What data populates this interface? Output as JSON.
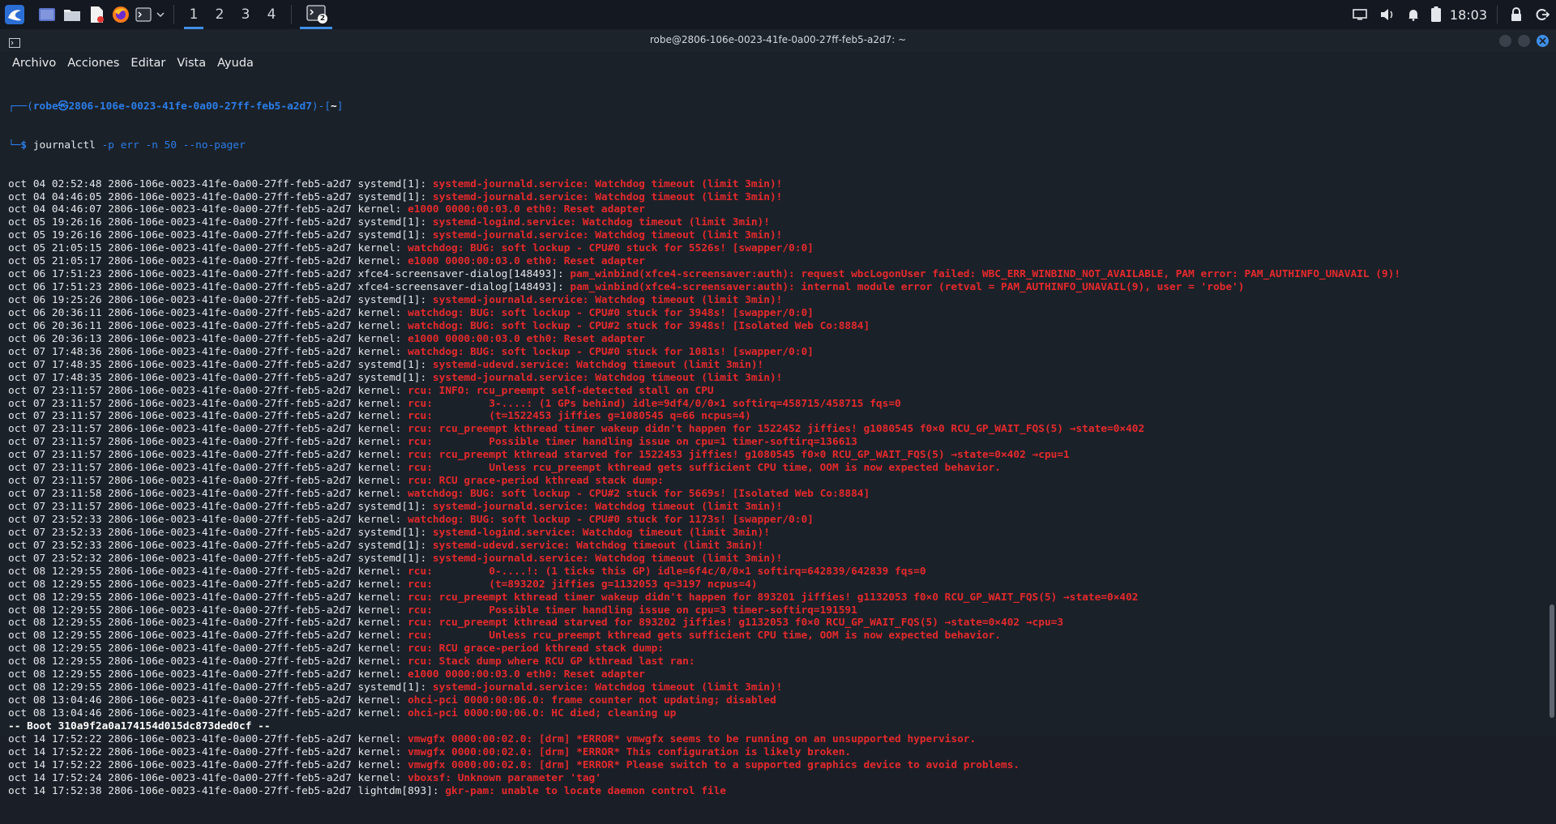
{
  "panel": {
    "workspaces": [
      "1",
      "2",
      "3",
      "4"
    ],
    "active_workspace": 0,
    "clock": "18:03",
    "task_badge": "2"
  },
  "window": {
    "title": "robe@2806-106e-0023-41fe-0a00-27ff-feb5-a2d7: ~",
    "menu": [
      "Archivo",
      "Acciones",
      "Editar",
      "Vista",
      "Ayuda"
    ]
  },
  "prompt": {
    "user_host": "robe㉿2806-106e-0023-41fe-0a00-27ff-feb5-a2d7",
    "path": "~",
    "command": "journalctl",
    "args": " -p err -n 50 --no-pager"
  },
  "log_lines": [
    {
      "p": "oct 04 02:52:48 2806-106e-0023-41fe-0a00-27ff-feb5-a2d7 systemd[1]: ",
      "m": "systemd-journald.service: Watchdog timeout (limit 3min)!"
    },
    {
      "p": "oct 04 04:46:05 2806-106e-0023-41fe-0a00-27ff-feb5-a2d7 systemd[1]: ",
      "m": "systemd-journald.service: Watchdog timeout (limit 3min)!"
    },
    {
      "p": "oct 04 04:46:07 2806-106e-0023-41fe-0a00-27ff-feb5-a2d7 kernel: ",
      "m": "e1000 0000:00:03.0 eth0: Reset adapter"
    },
    {
      "p": "oct 05 19:26:16 2806-106e-0023-41fe-0a00-27ff-feb5-a2d7 systemd[1]: ",
      "m": "systemd-logind.service: Watchdog timeout (limit 3min)!"
    },
    {
      "p": "oct 05 19:26:16 2806-106e-0023-41fe-0a00-27ff-feb5-a2d7 systemd[1]: ",
      "m": "systemd-journald.service: Watchdog timeout (limit 3min)!"
    },
    {
      "p": "oct 05 21:05:15 2806-106e-0023-41fe-0a00-27ff-feb5-a2d7 kernel: ",
      "m": "watchdog: BUG: soft lockup - CPU#0 stuck for 5526s! [swapper/0:0]"
    },
    {
      "p": "oct 05 21:05:17 2806-106e-0023-41fe-0a00-27ff-feb5-a2d7 kernel: ",
      "m": "e1000 0000:00:03.0 eth0: Reset adapter"
    },
    {
      "p": "oct 06 17:51:23 2806-106e-0023-41fe-0a00-27ff-feb5-a2d7 xfce4-screensaver-dialog[148493]: ",
      "m": "pam_winbind(xfce4-screensaver:auth): request wbcLogonUser failed: WBC_ERR_WINBIND_NOT_AVAILABLE, PAM error: PAM_AUTHINFO_UNAVAIL (9)!"
    },
    {
      "p": "oct 06 17:51:23 2806-106e-0023-41fe-0a00-27ff-feb5-a2d7 xfce4-screensaver-dialog[148493]: ",
      "m": "pam_winbind(xfce4-screensaver:auth): internal module error (retval = PAM_AUTHINFO_UNAVAIL(9), user = 'robe')"
    },
    {
      "p": "oct 06 19:25:26 2806-106e-0023-41fe-0a00-27ff-feb5-a2d7 systemd[1]: ",
      "m": "systemd-journald.service: Watchdog timeout (limit 3min)!"
    },
    {
      "p": "oct 06 20:36:11 2806-106e-0023-41fe-0a00-27ff-feb5-a2d7 kernel: ",
      "m": "watchdog: BUG: soft lockup - CPU#0 stuck for 3948s! [swapper/0:0]"
    },
    {
      "p": "oct 06 20:36:11 2806-106e-0023-41fe-0a00-27ff-feb5-a2d7 kernel: ",
      "m": "watchdog: BUG: soft lockup - CPU#2 stuck for 3948s! [Isolated Web Co:8884]"
    },
    {
      "p": "oct 06 20:36:13 2806-106e-0023-41fe-0a00-27ff-feb5-a2d7 kernel: ",
      "m": "e1000 0000:00:03.0 eth0: Reset adapter"
    },
    {
      "p": "oct 07 17:48:36 2806-106e-0023-41fe-0a00-27ff-feb5-a2d7 kernel: ",
      "m": "watchdog: BUG: soft lockup - CPU#0 stuck for 1081s! [swapper/0:0]"
    },
    {
      "p": "oct 07 17:48:35 2806-106e-0023-41fe-0a00-27ff-feb5-a2d7 systemd[1]: ",
      "m": "systemd-udevd.service: Watchdog timeout (limit 3min)!"
    },
    {
      "p": "oct 07 17:48:35 2806-106e-0023-41fe-0a00-27ff-feb5-a2d7 systemd[1]: ",
      "m": "systemd-journald.service: Watchdog timeout (limit 3min)!"
    },
    {
      "p": "oct 07 23:11:57 2806-106e-0023-41fe-0a00-27ff-feb5-a2d7 kernel: ",
      "m": "rcu: INFO: rcu_preempt self-detected stall on CPU"
    },
    {
      "p": "oct 07 23:11:57 2806-106e-0023-41fe-0a00-27ff-feb5-a2d7 kernel: ",
      "m": "rcu:         3-....: (1 GPs behind) idle=9df4/0/0×1 softirq=458715/458715 fqs=0"
    },
    {
      "p": "oct 07 23:11:57 2806-106e-0023-41fe-0a00-27ff-feb5-a2d7 kernel: ",
      "m": "rcu:         (t=1522453 jiffies g=1080545 q=66 ncpus=4)"
    },
    {
      "p": "oct 07 23:11:57 2806-106e-0023-41fe-0a00-27ff-feb5-a2d7 kernel: ",
      "m": "rcu: rcu_preempt kthread timer wakeup didn't happen for 1522452 jiffies! g1080545 f0×0 RCU_GP_WAIT_FQS(5) →state=0×402"
    },
    {
      "p": "oct 07 23:11:57 2806-106e-0023-41fe-0a00-27ff-feb5-a2d7 kernel: ",
      "m": "rcu:         Possible timer handling issue on cpu=1 timer-softirq=136613"
    },
    {
      "p": "oct 07 23:11:57 2806-106e-0023-41fe-0a00-27ff-feb5-a2d7 kernel: ",
      "m": "rcu: rcu_preempt kthread starved for 1522453 jiffies! g1080545 f0×0 RCU_GP_WAIT_FQS(5) →state=0×402 →cpu=1"
    },
    {
      "p": "oct 07 23:11:57 2806-106e-0023-41fe-0a00-27ff-feb5-a2d7 kernel: ",
      "m": "rcu:         Unless rcu_preempt kthread gets sufficient CPU time, OOM is now expected behavior."
    },
    {
      "p": "oct 07 23:11:57 2806-106e-0023-41fe-0a00-27ff-feb5-a2d7 kernel: ",
      "m": "rcu: RCU grace-period kthread stack dump:"
    },
    {
      "p": "oct 07 23:11:58 2806-106e-0023-41fe-0a00-27ff-feb5-a2d7 kernel: ",
      "m": "watchdog: BUG: soft lockup - CPU#2 stuck for 5669s! [Isolated Web Co:8884]"
    },
    {
      "p": "oct 07 23:11:57 2806-106e-0023-41fe-0a00-27ff-feb5-a2d7 systemd[1]: ",
      "m": "systemd-journald.service: Watchdog timeout (limit 3min)!"
    },
    {
      "p": "oct 07 23:52:33 2806-106e-0023-41fe-0a00-27ff-feb5-a2d7 kernel: ",
      "m": "watchdog: BUG: soft lockup - CPU#0 stuck for 1173s! [swapper/0:0]"
    },
    {
      "p": "oct 07 23:52:33 2806-106e-0023-41fe-0a00-27ff-feb5-a2d7 systemd[1]: ",
      "m": "systemd-logind.service: Watchdog timeout (limit 3min)!"
    },
    {
      "p": "oct 07 23:52:33 2806-106e-0023-41fe-0a00-27ff-feb5-a2d7 systemd[1]: ",
      "m": "systemd-udevd.service: Watchdog timeout (limit 3min)!"
    },
    {
      "p": "oct 07 23:52:32 2806-106e-0023-41fe-0a00-27ff-feb5-a2d7 systemd[1]: ",
      "m": "systemd-journald.service: Watchdog timeout (limit 3min)!"
    },
    {
      "p": "oct 08 12:29:55 2806-106e-0023-41fe-0a00-27ff-feb5-a2d7 kernel: ",
      "m": "rcu:         0-....!: (1 ticks this GP) idle=6f4c/0/0×1 softirq=642839/642839 fqs=0"
    },
    {
      "p": "oct 08 12:29:55 2806-106e-0023-41fe-0a00-27ff-feb5-a2d7 kernel: ",
      "m": "rcu:         (t=893202 jiffies g=1132053 q=3197 ncpus=4)"
    },
    {
      "p": "oct 08 12:29:55 2806-106e-0023-41fe-0a00-27ff-feb5-a2d7 kernel: ",
      "m": "rcu: rcu_preempt kthread timer wakeup didn't happen for 893201 jiffies! g1132053 f0×0 RCU_GP_WAIT_FQS(5) →state=0×402"
    },
    {
      "p": "oct 08 12:29:55 2806-106e-0023-41fe-0a00-27ff-feb5-a2d7 kernel: ",
      "m": "rcu:         Possible timer handling issue on cpu=3 timer-softirq=191591"
    },
    {
      "p": "oct 08 12:29:55 2806-106e-0023-41fe-0a00-27ff-feb5-a2d7 kernel: ",
      "m": "rcu: rcu_preempt kthread starved for 893202 jiffies! g1132053 f0×0 RCU_GP_WAIT_FQS(5) →state=0×402 →cpu=3"
    },
    {
      "p": "oct 08 12:29:55 2806-106e-0023-41fe-0a00-27ff-feb5-a2d7 kernel: ",
      "m": "rcu:         Unless rcu_preempt kthread gets sufficient CPU time, OOM is now expected behavior."
    },
    {
      "p": "oct 08 12:29:55 2806-106e-0023-41fe-0a00-27ff-feb5-a2d7 kernel: ",
      "m": "rcu: RCU grace-period kthread stack dump:"
    },
    {
      "p": "oct 08 12:29:55 2806-106e-0023-41fe-0a00-27ff-feb5-a2d7 kernel: ",
      "m": "rcu: Stack dump where RCU GP kthread last ran:"
    },
    {
      "p": "oct 08 12:29:55 2806-106e-0023-41fe-0a00-27ff-feb5-a2d7 kernel: ",
      "m": "e1000 0000:00:03.0 eth0: Reset adapter"
    },
    {
      "p": "oct 08 12:29:55 2806-106e-0023-41fe-0a00-27ff-feb5-a2d7 systemd[1]: ",
      "m": "systemd-journald.service: Watchdog timeout (limit 3min)!"
    },
    {
      "p": "oct 08 13:04:46 2806-106e-0023-41fe-0a00-27ff-feb5-a2d7 kernel: ",
      "m": "ohci-pci 0000:00:06.0: frame counter not updating; disabled"
    },
    {
      "p": "oct 08 13:04:46 2806-106e-0023-41fe-0a00-27ff-feb5-a2d7 kernel: ",
      "m": "ohci-pci 0000:00:06.0: HC died; cleaning up"
    },
    {
      "boot": "-- Boot 310a9f2a0a174154d015dc873ded0cf --"
    },
    {
      "p": "oct 14 17:52:22 2806-106e-0023-41fe-0a00-27ff-feb5-a2d7 kernel: ",
      "m": "vmwgfx 0000:00:02.0: [drm] *ERROR* vmwgfx seems to be running on an unsupported hypervisor."
    },
    {
      "p": "oct 14 17:52:22 2806-106e-0023-41fe-0a00-27ff-feb5-a2d7 kernel: ",
      "m": "vmwgfx 0000:00:02.0: [drm] *ERROR* This configuration is likely broken."
    },
    {
      "p": "oct 14 17:52:22 2806-106e-0023-41fe-0a00-27ff-feb5-a2d7 kernel: ",
      "m": "vmwgfx 0000:00:02.0: [drm] *ERROR* Please switch to a supported graphics device to avoid problems."
    },
    {
      "p": "oct 14 17:52:24 2806-106e-0023-41fe-0a00-27ff-feb5-a2d7 kernel: ",
      "m": "vboxsf: Unknown parameter 'tag'"
    },
    {
      "p": "oct 14 17:52:38 2806-106e-0023-41fe-0a00-27ff-feb5-a2d7 lightdm[893]: ",
      "m": "gkr-pam: unable to locate daemon control file"
    }
  ],
  "colors": {
    "error_text": "#e6292c",
    "prompt_blue": "#2b7de8",
    "panel_bg": "#141820",
    "terminal_bg": "#1b2129",
    "active_indicator": "#3d8fe6"
  }
}
